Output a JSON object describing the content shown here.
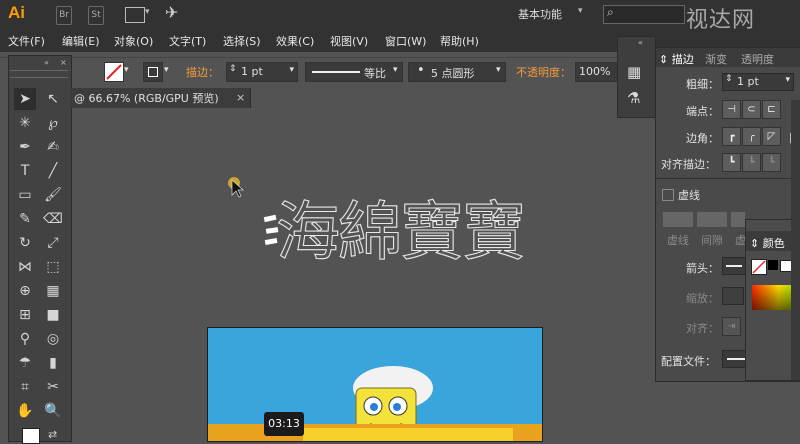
{
  "app": {
    "logo": "Ai",
    "buttons": [
      "Br",
      "St"
    ],
    "workspace": "基本功能",
    "watermark": "视达网"
  },
  "menu": [
    "文件(F)",
    "编辑(E)",
    "对象(O)",
    "文字(T)",
    "选择(S)",
    "效果(C)",
    "视图(V)",
    "窗口(W)",
    "帮助(H)"
  ],
  "control": {
    "stroke_label": "描边：",
    "stroke_value": "1 pt",
    "profile": "等比",
    "brush": "5 点圆形",
    "opacity_label": "不透明度：",
    "opacity_value": "100%"
  },
  "document": {
    "tab_title": "@ 66.67% (RGB/GPU 预览)"
  },
  "artwork": {
    "outline_text": "海綿寶寶",
    "timecode": "03:13"
  },
  "stroke_panel": {
    "tabs": [
      "描边",
      "渐变",
      "透明度"
    ],
    "weight_label": "粗细：",
    "weight_value": "1 pt",
    "cap_label": "端点：",
    "corner_label": "边角：",
    "limit_label": "限",
    "align_label": "对齐描边：",
    "dashed_label": "虚线",
    "dash_fields": [
      "虚线",
      "间隙",
      "虚"
    ],
    "arrow_label": "箭头：",
    "scale_label": "缩放：",
    "align2_label": "对齐：",
    "profile_label": "配置文件：",
    "profile_value": "等比"
  },
  "color_panel": {
    "tab": "颜色",
    "tab2": "颜"
  },
  "colors": {
    "accent": "#f29d38",
    "artboard": "#3aa4dc",
    "logo": "#ff9a00"
  }
}
